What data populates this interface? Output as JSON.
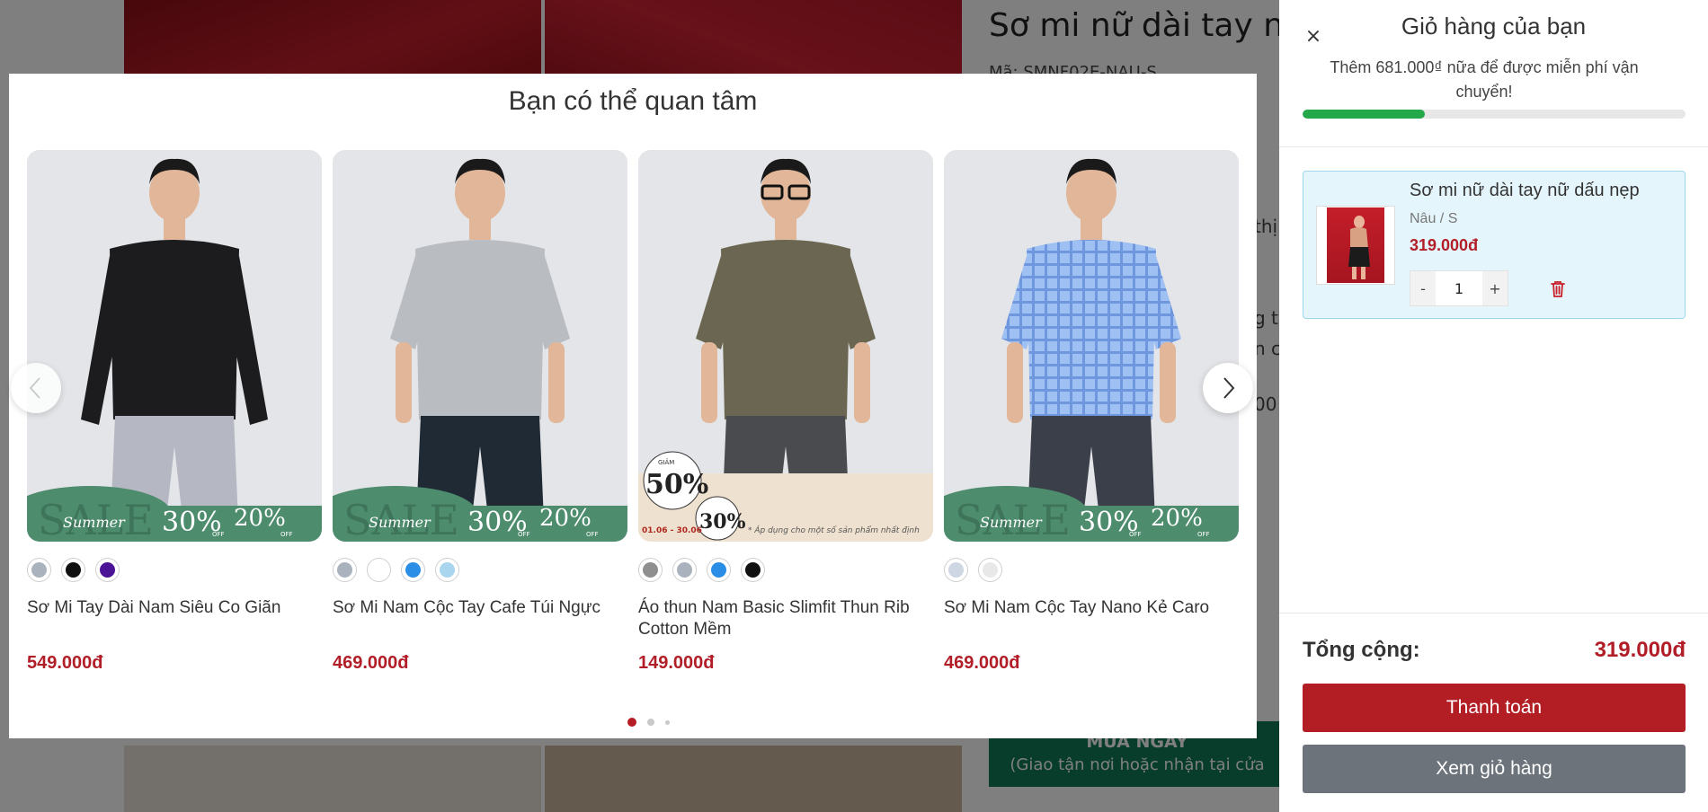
{
  "background": {
    "product_title": "Sơ mi nữ dài tay nữ",
    "product_sku": "Mã: SMNF02E-NAU-S",
    "buy_now": "MUA NGAY",
    "buy_now_sub": "(Giao tận nơi hoặc nhận tại cửa",
    "fragment_1": "thị",
    "fragment_2": "g từ",
    "fragment_3": "n c",
    "fragment_4": "00"
  },
  "modal": {
    "title": "Bạn có thể quan tâm",
    "products": [
      {
        "name": "Sơ Mi Tay Dài Nam Siêu Co Giãn",
        "price": "549.000đ",
        "swatches": [
          "#aab3bd",
          "#111111",
          "#4b1497"
        ],
        "shirt_color": "#1c1c1e",
        "pants_color": "#b5b8c2",
        "banner": "summer"
      },
      {
        "name": "Sơ Mi Nam Cộc Tay Cafe Túi Ngực",
        "price": "469.000đ",
        "swatches": [
          "#aab3bd",
          "#ffffff",
          "#2a8ee6",
          "#a9d5ef"
        ],
        "shirt_color": "#b9bcc1",
        "pants_color": "#1f2a35",
        "banner": "summer"
      },
      {
        "name": "Áo thun Nam Basic Slimfit Thun Rib Cotton Mềm",
        "price": "149.000đ",
        "swatches": [
          "#8f8f8f",
          "#aab3bd",
          "#2a8ee6",
          "#111111"
        ],
        "shirt_color": "#6a6651",
        "pants_color": "#4a4b4e",
        "banner": "discount"
      },
      {
        "name": "Sơ Mi Nam Cộc Tay Nano Kẻ Caro",
        "price": "469.000đ",
        "swatches": [
          "#cfd6e3",
          "#e8e8e8"
        ],
        "shirt_color": "#9ec0f2",
        "pants_color": "#3b3f4a",
        "banner": "summer"
      }
    ],
    "banner_text": {
      "sale": "SALE",
      "summer": "Summer",
      "off30": "30%",
      "off20": "20%",
      "off": "OFF",
      "discount_word": "GIẢM",
      "discount50": "50%",
      "discount30": "30%",
      "dates": "01.06 - 30.06",
      "note": "* Áp dụng cho một số sản phẩm nhất định"
    },
    "page_dots": 3,
    "active_dot": 0
  },
  "cart": {
    "title": "Giỏ hàng của bạn",
    "shipping_message": "Thêm 681.000₫ nữa để được miễn phí vận chuyển!",
    "shipping_progress": 0.32,
    "item": {
      "name": "Sơ mi nữ dài tay nữ dấu nẹp",
      "variant": "Nâu / S",
      "price": "319.000đ",
      "quantity": "1",
      "minus": "-",
      "plus": "+"
    },
    "total_label": "Tổng cộng:",
    "total_value": "319.000đ",
    "checkout_label": "Thanh toán",
    "view_cart_label": "Xem giỏ hàng",
    "close_icon": "×"
  },
  "colors": {
    "accent_red": "#b31d24",
    "progress_green": "#23a84a",
    "banner_green": "#4e8c6e"
  }
}
